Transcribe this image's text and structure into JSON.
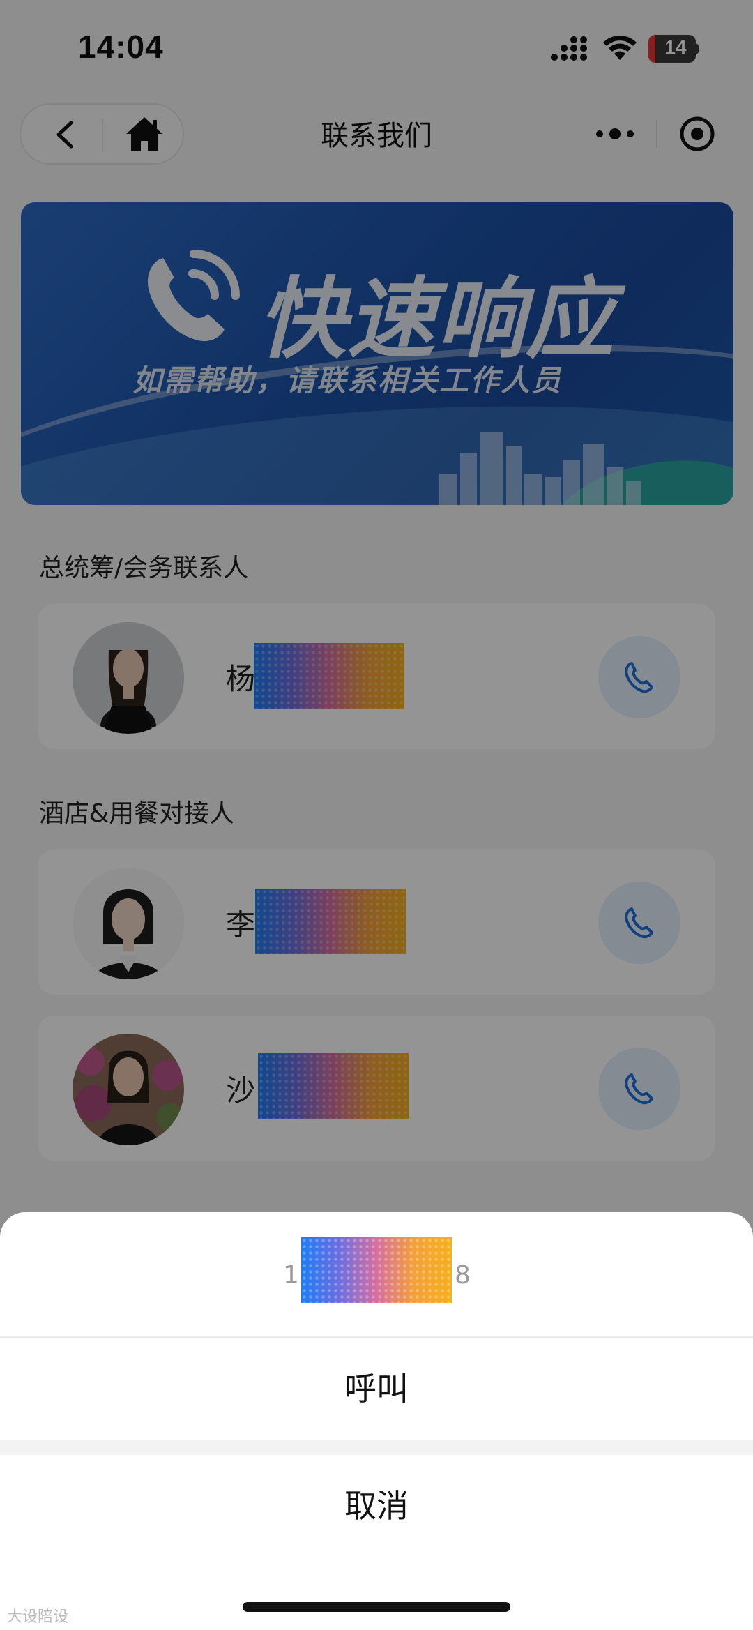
{
  "status_bar": {
    "time": "14:04",
    "battery": "14"
  },
  "nav": {
    "title": "联系我们"
  },
  "banner": {
    "title": "快速响应",
    "subtitle": "如需帮助，请联系相关工作人员"
  },
  "sections": [
    {
      "label": "总统筹/会务联系人",
      "contacts": [
        {
          "name_prefix": "杨"
        }
      ]
    },
    {
      "label": "酒店&用餐对接人",
      "contacts": [
        {
          "name_prefix": "李"
        },
        {
          "name_prefix": "沙"
        }
      ]
    }
  ],
  "sheet": {
    "number_prefix": "13",
    "number_suffix": "8",
    "call_label": "呼叫",
    "cancel_label": "取消"
  },
  "watermark": "大设陪设",
  "colors": {
    "accent_blue": "#1e6fd9",
    "call_bg": "#e3effc",
    "banner": "#1f56ad"
  }
}
